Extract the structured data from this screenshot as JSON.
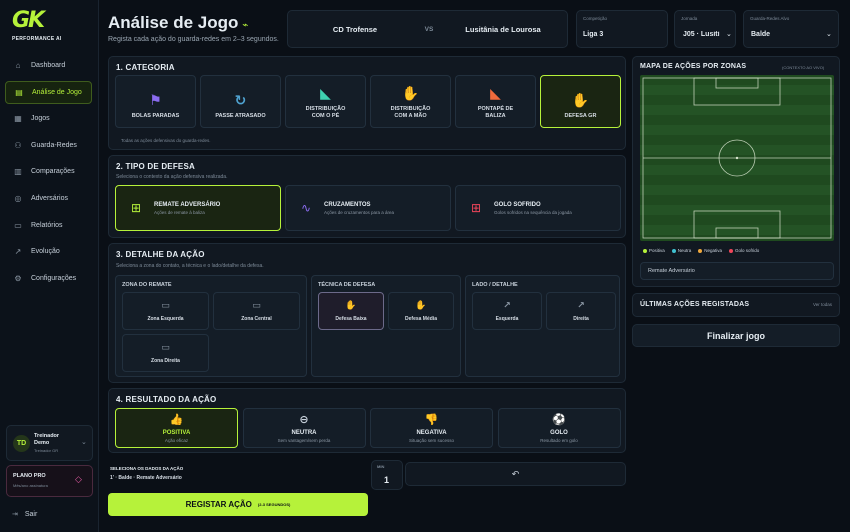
{
  "brand": {
    "logo": "GK",
    "subtitle": "PERFORMANCE AI"
  },
  "nav": [
    {
      "label": "Dashboard",
      "icon": "home-icon",
      "glyph": "⌂"
    },
    {
      "label": "Análise de Jogo",
      "icon": "clipboard-icon",
      "glyph": "▤",
      "active": true
    },
    {
      "label": "Jogos",
      "icon": "calendar-icon",
      "glyph": "▦"
    },
    {
      "label": "Guarda-Redes",
      "icon": "users-icon",
      "glyph": "⚇"
    },
    {
      "label": "Comparações",
      "icon": "chart-icon",
      "glyph": "▥"
    },
    {
      "label": "Adversários",
      "icon": "target-icon",
      "glyph": "◎"
    },
    {
      "label": "Relatórios",
      "icon": "file-icon",
      "glyph": "▭"
    },
    {
      "label": "Evolução",
      "icon": "trend-icon",
      "glyph": "↗"
    },
    {
      "label": "Configurações",
      "icon": "gear-icon",
      "glyph": "⚙"
    }
  ],
  "user": {
    "initials": "TD",
    "name_line1": "Treinador",
    "name_line2": "Demo",
    "role": "Treinador GR"
  },
  "plan": {
    "title": "PLANO PRO",
    "desc": "Mês/ano assinatura"
  },
  "logout": "Sair",
  "header": {
    "title": "Análise de Jogo",
    "subtitle": "Regista cada ação do guarda-redes em 2–3 segundos."
  },
  "match": {
    "home": "CD Trofense",
    "vs": "VS",
    "away": "Lusitânia de Lourosa"
  },
  "competition": {
    "label": "Competição",
    "value": "Liga 3"
  },
  "round": {
    "label": "Jornada",
    "value": "J05 · Lusiti"
  },
  "goalkeeper": {
    "label": "Guarda-Redes Alvo",
    "value": "Balde"
  },
  "category": {
    "title": "1. CATEGORIA",
    "note": "Todas as ações defensivas do guarda-redes.",
    "items": [
      {
        "label": "BOLAS PARADAS",
        "glyph": "⚑",
        "color": "#8b6cf0"
      },
      {
        "label": "PASSE ATRASADO",
        "glyph": "↻",
        "color": "#4fa3d1"
      },
      {
        "label": "DISTRIBUIÇÃO\nCOM O PÉ",
        "glyph": "◣",
        "color": "#3fd1b0"
      },
      {
        "label": "DISTRIBUIÇÃO\nCOM A MÃO",
        "glyph": "✋",
        "color": "#f0a83c"
      },
      {
        "label": "PONTAPÉ DE\nBALIZA",
        "glyph": "◣",
        "color": "#f06a3c"
      },
      {
        "label": "DEFESA GR",
        "glyph": "✋",
        "color": "#b6f23a",
        "selected": true
      }
    ]
  },
  "defense": {
    "title": "2. TIPO DE DEFESA",
    "note": "Seleciona o contexto da ação defensiva realizada.",
    "items": [
      {
        "label": "REMATE ADVERSÁRIO",
        "desc": "Ações de remate à baliza",
        "glyph": "⊞",
        "color": "#b6f23a",
        "selected": true
      },
      {
        "label": "CRUZAMENTOS",
        "desc": "Ações de cruzamentos para a área",
        "glyph": "∿",
        "color": "#8b6cf0"
      },
      {
        "label": "GOLO SOFRIDO",
        "desc": "Golos sofridos na sequência da jogada",
        "glyph": "⊞",
        "color": "#f0465a"
      }
    ]
  },
  "detail": {
    "title": "3. DETALHE DA AÇÃO",
    "note": "Seleciona a zona do contato, a técnica e o lado/detalhe da defesa.",
    "zone_title": "ZONA DO REMATE",
    "zones": [
      "Zona Esquerda",
      "Zona Central",
      "Zona Direita"
    ],
    "technique_title": "TÉCNICA DE DEFESA",
    "techniques": [
      {
        "label": "Defesa Baixa",
        "selected": true
      },
      {
        "label": "Defesa Média"
      }
    ],
    "side_title": "LADO / DETALHE",
    "sides": [
      "Esquerda",
      "Direita"
    ]
  },
  "result": {
    "title": "4. RESULTADO DA AÇÃO",
    "items": [
      {
        "label": "POSITIVA",
        "desc": "Ação eficaz",
        "glyph": "👍",
        "selected": true
      },
      {
        "label": "NEUTRA",
        "desc": "Sem vantagem/sem perda",
        "glyph": "⊖"
      },
      {
        "label": "NEGATIVA",
        "desc": "Situação sem sucesso",
        "glyph": "👎"
      },
      {
        "label": "GOLO",
        "desc": "Resultado em golo",
        "glyph": "⚽"
      }
    ]
  },
  "summary": {
    "label": "SELECIONA OS DADOS DA AÇÃO",
    "value": "1' · Balde · Remate Adversário"
  },
  "minute": {
    "label": "MIN",
    "value": "1"
  },
  "undo_glyph": "↶",
  "register": {
    "label": "REGISTAR AÇÃO",
    "hint": "(2-3 SEGUNDOS)"
  },
  "map": {
    "title": "MAPA DE AÇÕES POR ZONAS",
    "tag": "(CONTEXTO AO VIVO)",
    "legend": [
      {
        "label": "Positiva",
        "color": "#b6f23a"
      },
      {
        "label": "Neutra",
        "color": "#3fc1d1"
      },
      {
        "label": "Negativa",
        "color": "#f0a83c"
      },
      {
        "label": "Golo sofrido",
        "color": "#f0465a"
      }
    ],
    "context": "Remate Adversário"
  },
  "recent": {
    "title": "ÚLTIMAS AÇÕES REGISTADAS",
    "link": "Ver todas"
  },
  "finish": {
    "label": "Finalizar jogo"
  }
}
